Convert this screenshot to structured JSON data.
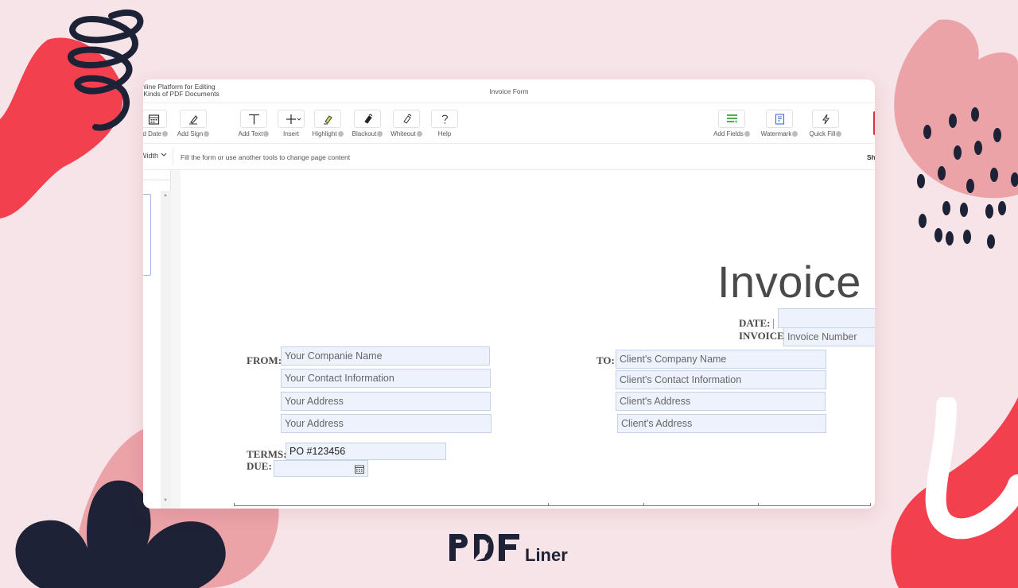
{
  "app": {
    "tagline": "nline Platform for Editing\n Kinds of PDF Documents",
    "document_title": "Invoice Form"
  },
  "toolbar": {
    "left_tools": [
      {
        "label": "dd Date",
        "icon": "calendar-icon"
      },
      {
        "label": "Add Sign",
        "icon": "pen-icon"
      },
      {
        "label": "Add Text",
        "icon": "text-t-icon"
      },
      {
        "label": "Insert",
        "icon": "plus-icon"
      },
      {
        "label": "Highlight",
        "icon": "highlighter-icon"
      },
      {
        "label": "Blackout",
        "icon": "blackout-brush-icon"
      },
      {
        "label": "Whiteout",
        "icon": "whiteout-brush-icon"
      },
      {
        "label": "Help",
        "icon": "question-icon"
      }
    ],
    "right_tools": [
      {
        "label": "Add Fields",
        "icon": "fields-icon"
      },
      {
        "label": "Watermark",
        "icon": "watermark-icon"
      },
      {
        "label": "Quick Fill",
        "icon": "lightning-icon"
      }
    ],
    "accent": "#4caf50"
  },
  "subbar": {
    "zoom_value": "Width",
    "hint": "Fill the form or use another tools to change page content",
    "right_text": "Sh"
  },
  "invoice": {
    "title": "Invoice",
    "date_label": "DATE:",
    "date_value": "",
    "invoice_label": "INVOICE",
    "invoice_number_placeholder": "Invoice Number",
    "from_label": "FROM:",
    "from_fields": [
      "Your Companie Name",
      "Your Contact Information",
      "Your Address",
      "Your Address"
    ],
    "to_label": "TO:",
    "to_fields": [
      "Client's Company Name",
      "Client's Contact Information",
      "Client's Address",
      "Client's Address"
    ],
    "terms_label": "TERMS:",
    "terms_value": "PO #123456",
    "due_label": "DUE:",
    "due_value": ""
  },
  "brand": {
    "logo_text": "PDF",
    "logo_suffix": "Liner",
    "colors": {
      "navy": "#1e2236",
      "red": "#f2404f",
      "pink": "#eba3a8",
      "background": "#f7e4e8",
      "field": "#eef2fd"
    }
  }
}
